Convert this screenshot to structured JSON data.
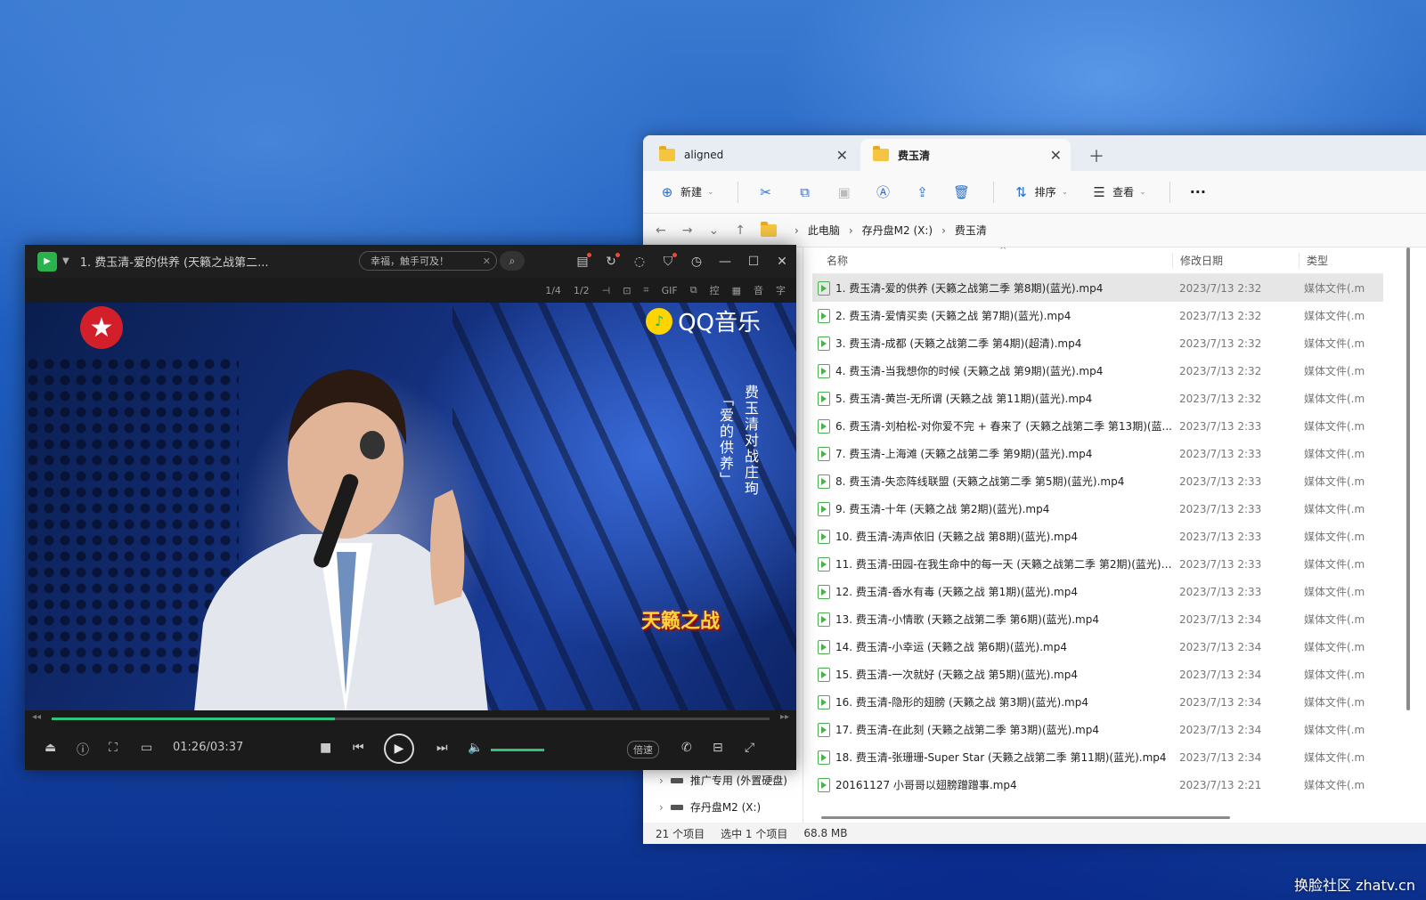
{
  "explorer": {
    "tabs": [
      {
        "label": "aligned",
        "active": false
      },
      {
        "label": "费玉清",
        "active": true
      }
    ],
    "toolbar": {
      "new_label": "新建",
      "sort_label": "排序",
      "view_label": "查看",
      "more_label": "···"
    },
    "breadcrumb": [
      "此电脑",
      "存丹盘M2 (X:)",
      "费玉清"
    ],
    "columns": {
      "name": "名称",
      "date": "修改日期",
      "type": "类型"
    },
    "files": [
      {
        "name": "1. 费玉清-爱的供养 (天籁之战第二季 第8期)(蓝光).mp4",
        "date": "2023/7/13 2:32",
        "type": "媒体文件(.m"
      },
      {
        "name": "2. 费玉清-爱情买卖 (天籁之战 第7期)(蓝光).mp4",
        "date": "2023/7/13 2:32",
        "type": "媒体文件(.m"
      },
      {
        "name": "3. 费玉清-成都 (天籁之战第二季 第4期)(超清).mp4",
        "date": "2023/7/13 2:32",
        "type": "媒体文件(.m"
      },
      {
        "name": "4. 费玉清-当我想你的时候 (天籁之战 第9期)(蓝光).mp4",
        "date": "2023/7/13 2:32",
        "type": "媒体文件(.m"
      },
      {
        "name": "5. 费玉清-黄岂-无所谓 (天籁之战 第11期)(蓝光).mp4",
        "date": "2023/7/13 2:32",
        "type": "媒体文件(.m"
      },
      {
        "name": "6. 费玉清-刘柏松-对你爱不完 + 春来了 (天籁之战第二季 第13期)(蓝...",
        "date": "2023/7/13 2:33",
        "type": "媒体文件(.m"
      },
      {
        "name": "7. 费玉清-上海滩 (天籁之战第二季 第9期)(蓝光).mp4",
        "date": "2023/7/13 2:33",
        "type": "媒体文件(.m"
      },
      {
        "name": "8. 费玉清-失恋阵线联盟 (天籁之战第二季 第5期)(蓝光).mp4",
        "date": "2023/7/13 2:33",
        "type": "媒体文件(.m"
      },
      {
        "name": "9. 费玉清-十年 (天籁之战 第2期)(蓝光).mp4",
        "date": "2023/7/13 2:33",
        "type": "媒体文件(.m"
      },
      {
        "name": "10. 费玉清-涛声依旧 (天籁之战 第8期)(蓝光).mp4",
        "date": "2023/7/13 2:33",
        "type": "媒体文件(.m"
      },
      {
        "name": "11. 费玉清-田园-在我生命中的每一天 (天籁之战第二季 第2期)(蓝光)....",
        "date": "2023/7/13 2:33",
        "type": "媒体文件(.m"
      },
      {
        "name": "12. 费玉清-香水有毒 (天籁之战 第1期)(蓝光).mp4",
        "date": "2023/7/13 2:33",
        "type": "媒体文件(.m"
      },
      {
        "name": "13. 费玉清-小情歌 (天籁之战第二季 第6期)(蓝光).mp4",
        "date": "2023/7/13 2:34",
        "type": "媒体文件(.m"
      },
      {
        "name": "14. 费玉清-小幸运 (天籁之战 第6期)(蓝光).mp4",
        "date": "2023/7/13 2:34",
        "type": "媒体文件(.m"
      },
      {
        "name": "15. 费玉清-一次就好 (天籁之战 第5期)(蓝光).mp4",
        "date": "2023/7/13 2:34",
        "type": "媒体文件(.m"
      },
      {
        "name": "16. 费玉清-隐形的翅膀 (天籁之战 第3期)(蓝光).mp4",
        "date": "2023/7/13 2:34",
        "type": "媒体文件(.m"
      },
      {
        "name": "17. 费玉清-在此刻 (天籁之战第二季 第3期)(蓝光).mp4",
        "date": "2023/7/13 2:34",
        "type": "媒体文件(.m"
      },
      {
        "name": "18. 费玉清-张珊珊-Super Star (天籁之战第二季 第11期)(蓝光).mp4",
        "date": "2023/7/13 2:34",
        "type": "媒体文件(.m"
      },
      {
        "name": "20161127 小哥哥以翅膀蹭蹭事.mp4",
        "date": "2023/7/13 2:21",
        "type": "媒体文件(.m"
      }
    ],
    "nav": {
      "item1": "推广专用 (外置硬盘)",
      "item2": "存丹盘M2 (X:)"
    },
    "status": {
      "count": "21 个项目",
      "selected": "选中 1 个项目",
      "size": "68.8 MB"
    }
  },
  "player": {
    "title": "1. 费玉清-爱的供养 (天籁之战第二...",
    "search_text": "幸福，触手可及！",
    "subbar": [
      "1/4",
      "1/2",
      "⊣",
      "⊡",
      "⌗",
      "GIF",
      "⧉",
      "控",
      "▦",
      "音",
      "字"
    ],
    "time": "01:26/03:37",
    "progress": 0.395,
    "volume": 1.0,
    "speed_label": "倍速",
    "video": {
      "brand": "QQ音乐",
      "caption_right": "费玉清对战庄珣",
      "caption_left": "「爱的供养」",
      "show_logo": "天籁之战"
    }
  },
  "watermark": "换脸社区 zhatv.cn",
  "colors": {
    "accent_green": "#31c27c",
    "explorer_bg": "#f3f3f3"
  }
}
